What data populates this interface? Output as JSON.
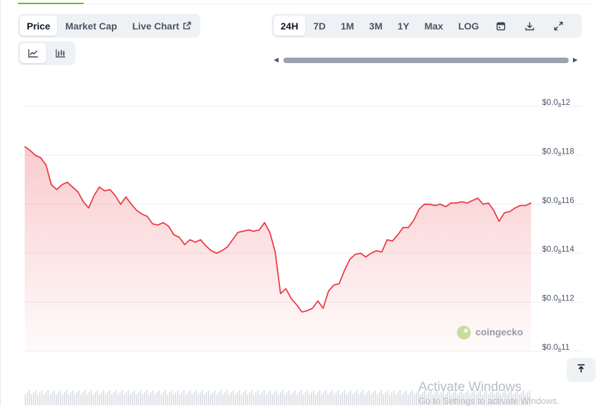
{
  "metric_tabs": [
    {
      "label": "Price",
      "active": true
    },
    {
      "label": "Market Cap",
      "active": false
    },
    {
      "label": "Live Chart",
      "active": false,
      "icon": "external-link-icon"
    }
  ],
  "chart_type_toggle": [
    {
      "icon": "line-chart-icon",
      "active": true
    },
    {
      "icon": "candlestick-chart-icon",
      "active": false
    }
  ],
  "range_tabs": [
    {
      "label": "24H",
      "active": true
    },
    {
      "label": "7D",
      "active": false
    },
    {
      "label": "1M",
      "active": false
    },
    {
      "label": "3M",
      "active": false
    },
    {
      "label": "1Y",
      "active": false
    },
    {
      "label": "Max",
      "active": false
    },
    {
      "label": "LOG",
      "active": false
    }
  ],
  "toolbar_icons": [
    "calendar-icon",
    "download-icon",
    "fullscreen-icon"
  ],
  "watermark": {
    "brand": "coingecko"
  },
  "activate_windows": {
    "title": "Activate Windows",
    "subtitle": "Go to Settings to activate Windows."
  },
  "colors": {
    "line": "#ea3943",
    "fill_top": "#ea3943",
    "accent": "#4bcc00",
    "tab_bg": "#eff2f5"
  },
  "chart_data": {
    "type": "area",
    "y_scale": "0.0000000 prefix: ticks shown as $0.0₈ followed by significant digits",
    "ylim": [
      110,
      120
    ],
    "yticks": [
      {
        "prefix": "$0.0",
        "sub": "8",
        "digits": "12",
        "value": 120
      },
      {
        "prefix": "$0.0",
        "sub": "8",
        "digits": "118",
        "value": 118
      },
      {
        "prefix": "$0.0",
        "sub": "8",
        "digits": "116",
        "value": 116
      },
      {
        "prefix": "$0.0",
        "sub": "8",
        "digits": "114",
        "value": 114
      },
      {
        "prefix": "$0.0",
        "sub": "8",
        "digits": "112",
        "value": 112
      },
      {
        "prefix": "$0.0",
        "sub": "8",
        "digits": "11",
        "value": 110
      }
    ],
    "grid": true,
    "series": [
      {
        "values": [
          118.35,
          118.2,
          118.0,
          117.9,
          117.6,
          116.8,
          116.6,
          116.8,
          116.9,
          116.7,
          116.5,
          116.1,
          115.85,
          116.35,
          116.7,
          116.55,
          116.6,
          116.35,
          116.0,
          116.3,
          116.0,
          115.75,
          115.6,
          115.5,
          115.2,
          115.15,
          115.25,
          115.1,
          114.75,
          114.65,
          114.35,
          114.55,
          114.45,
          114.55,
          114.3,
          114.1,
          114.0,
          114.1,
          114.25,
          114.55,
          114.85,
          114.9,
          114.95,
          114.9,
          114.95,
          115.25,
          114.85,
          114.05,
          112.35,
          112.55,
          112.15,
          111.9,
          111.6,
          111.65,
          111.75,
          112.05,
          111.75,
          112.45,
          112.7,
          112.75,
          113.3,
          113.75,
          113.95,
          114.0,
          113.85,
          114.0,
          114.1,
          114.05,
          114.55,
          114.5,
          114.75,
          115.05,
          115.05,
          115.35,
          115.8,
          116.0,
          116.0,
          115.95,
          116.0,
          115.9,
          116.05,
          116.05,
          116.1,
          116.05,
          116.15,
          116.25,
          116.0,
          116.05,
          115.75,
          115.3,
          115.65,
          115.7,
          115.85,
          115.95,
          115.95,
          116.05
        ]
      }
    ],
    "volume_strip": true
  }
}
